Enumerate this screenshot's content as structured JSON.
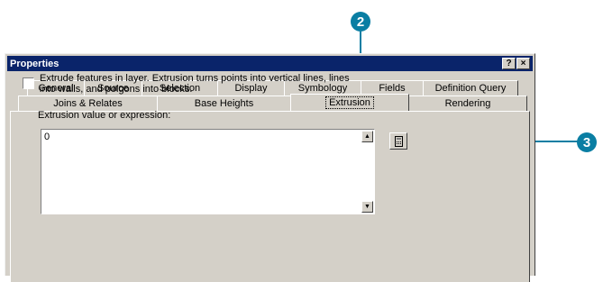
{
  "callouts": {
    "step2": "2",
    "step3": "3"
  },
  "dialog": {
    "title": "Properties",
    "help_button": "?",
    "close_button": "×",
    "tabs_row1": [
      "General",
      "Source",
      "Selection",
      "Display",
      "Symbology",
      "Fields",
      "Definition Query"
    ],
    "tabs_row2": [
      "Joins & Relates",
      "Base Heights",
      "Extrusion",
      "Rendering"
    ],
    "active_tab": "Extrusion",
    "extrusion": {
      "checkbox_label": "Extrude features in layer.  Extrusion turns points into vertical lines, lines into walls, and polgons into blocks.",
      "checkbox_checked": false,
      "expression_label": "Extrusion value or expression:",
      "expression_value": "0",
      "calculator_icon": "calculator-icon"
    }
  },
  "colors": {
    "callout": "#0a7ea3",
    "titlebar": "#0a246a",
    "face": "#d4d0c8"
  }
}
